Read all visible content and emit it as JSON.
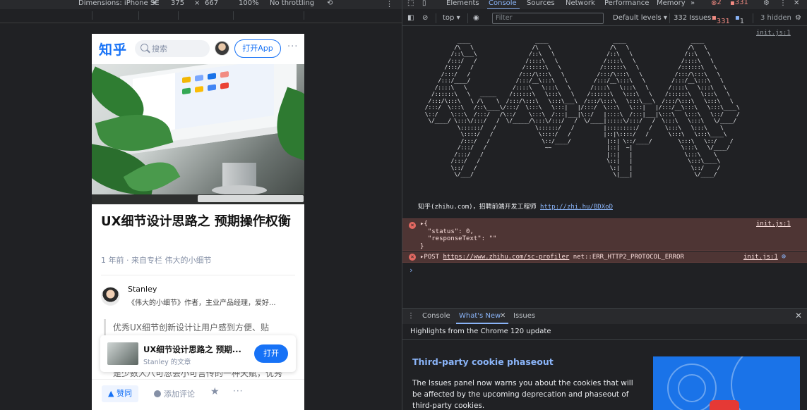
{
  "emulation": {
    "dimensions": "Dimensions: iPhone SE",
    "width": "375",
    "times": "×",
    "height": "667",
    "zoom": "100%",
    "throttle": "No throttling"
  },
  "zhihu": {
    "logo": "知乎",
    "search_placeholder": "搜索",
    "open_app": "打开App",
    "more": "···",
    "article_title": "UX细节设计思路之 预期操作权衡",
    "meta": "1 年前 · 来自专栏 伟大的小细节",
    "author_name": "Stanley",
    "author_bio": "《伟大的小细节》作者，主业产品经理，爱好...",
    "quote": "优秀UX细节创新设计让用户感到方便、贴",
    "quote_cont": "是少数人八可忽会小可言传的一种天赋，优秀",
    "card_title": "UX细节设计思路之 预期...",
    "card_sub": "Stanley 的文章",
    "card_btn": "打开",
    "vote": "▲ 赞同",
    "comment": "添加评论",
    "star": "★",
    "bottom_more": "···"
  },
  "devtools": {
    "tabs": [
      "Elements",
      "Console",
      "Sources",
      "Network",
      "Performance",
      "Memory",
      "»"
    ],
    "errors_count": "2",
    "warnings_count": "331",
    "context": "top ▾",
    "filter_placeholder": "Filter",
    "levels": "Default levels ▾",
    "issues_label": "332 Issues:",
    "issues_err": "331",
    "issues_info": "1",
    "hidden": "3 hidden",
    "source1": "init.js:1",
    "ascii_art": "             ____                    ____                    ____                    ____\n            /\\   \\                  /\\   \\                  /\\   \\                  /\\   \\\n           /::\\___\\                /::\\   \\                /::\\   \\                /::\\   \\\n          /:::/   /               /::::\\   \\              /::::\\   \\              /::::\\   \\\n         /:::/   /               /::::::\\   \\            /::::::\\   \\            /::::::\\   \\\n        /:::/   /               /:::/\\:::\\   \\          /:::/\\:::\\   \\          /:::/\\:::\\   \\\n       /:::/____/              /:::/__\\:::\\   \\        /:::/__\\:::\\   \\        /:::/__\\:::\\   \\\n      /::::\\   \\              /::::\\   \\:::\\   \\      /::::\\   \\:::\\   \\      /::::\\   \\:::\\   \\\n     /::::::\\   \\   _____    /::::::\\   \\:::\\   \\    /::::::\\   \\:::\\   \\    /::::::\\   \\:::\\   \\\n    /:::/\\:::\\   \\ /\\    \\  /:::/\\:::\\   \\:::\\___\\  /:::/\\:::\\   \\:::\\___\\  /:::/\\:::\\   \\:::\\   \\\n   /:::/  \\:::\\   /::\\____\\/:::/  \\:::\\   \\:::|   |/:::/  \\:::\\   \\:::|   |/:::/__\\:::\\   \\:::\\____\\\n   \\::/    \\:::\\  /:::/   /\\::/    \\:::\\  /:::|___|\\::/   |::::\\  /:::|___|\\:::\\   \\:::\\   \\::/    /\n    \\/____/ \\:::\\/:::/   /  \\/_____/\\:::\\/:::/   /  \\/____|:::::\\/:::/   /  \\:::\\   \\:::\\   \\/____/\n             \\::::::/   /            \\::::::/   /         |:::::::::/   /    \\:::\\   \\:::\\    \\\n              \\::::/   /              \\::::/   /          |::|\\::::/   /      \\:::\\   \\:::\\____\\\n              /:::/   /                \\::/____/           |::| \\::/____/        \\:::\\   \\::/    /\n             /:::/   /                  ~~                 |::|  ~|               \\:::\\   \\/____/\n            /:::/   /                                      |::|   |                \\:::\\    \\\n           /:::/   /                                       \\::|   |                 \\:::\\____\\\n           \\::/   /                                         \\:|   |                  \\::/    /\n            \\/___/                                           \\|___|                   \\/____/",
    "log_text": "知乎(zhihu.com)，招聘前端开发工程师 ",
    "log_url": "http://zhi.hu/BDXoD",
    "error1_body": "▸{\n  \"status\": 0,\n  \"responseText\": \"\"\n}",
    "error2_prefix": "▸POST ",
    "error2_url": "https://www.zhihu.com/sc-profiler",
    "error2_suffix": " net::ERR_HTTP2_PROTOCOL_ERROR",
    "prompt": "›",
    "drawer_tabs": [
      "Console",
      "What's New",
      "Issues"
    ],
    "drawer_close": "✕",
    "highlights": "Highlights from the Chrome 120 update",
    "wn_title": "Third-party cookie phaseout",
    "wn_body": "The Issues panel now warns you about the cookies that will be affected by the upcoming deprecation and phaseout of third-party cookies."
  }
}
